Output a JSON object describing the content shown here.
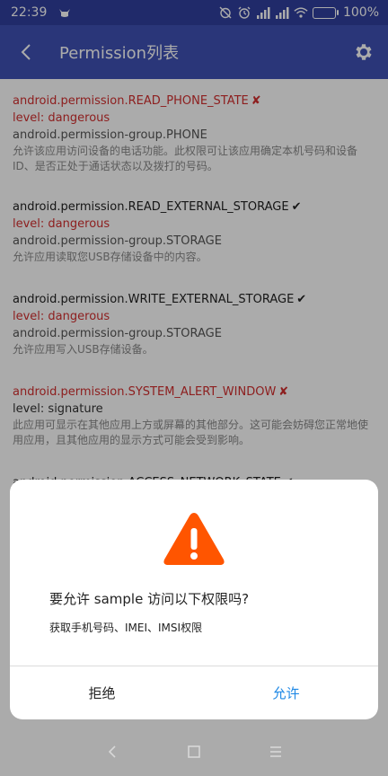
{
  "status_bar": {
    "time": "22:39",
    "battery_percent": "100%",
    "battery_level": 1.0
  },
  "app_bar": {
    "title": "Permission列表"
  },
  "permissions": [
    {
      "name": "android.permission.READ_PHONE_STATE",
      "mark": "✘",
      "granted": false,
      "level": "level: dangerous",
      "group": "android.permission-group.PHONE",
      "description": "允许该应用访问设备的电话功能。此权限可让该应用确定本机号码和设备 ID、是否正处于通话状态以及拨打的号码。"
    },
    {
      "name": "android.permission.READ_EXTERNAL_STORAGE",
      "mark": "✔",
      "granted": true,
      "level": "level: dangerous",
      "group": "android.permission-group.STORAGE",
      "description": "允许应用读取您USB存储设备中的内容。"
    },
    {
      "name": "android.permission.WRITE_EXTERNAL_STORAGE",
      "mark": "✔",
      "granted": true,
      "level": "level: dangerous",
      "group": "android.permission-group.STORAGE",
      "description": "允许应用写入USB存储设备。"
    },
    {
      "name": "android.permission.SYSTEM_ALERT_WINDOW",
      "mark": "✘",
      "granted": false,
      "level": "level: signature",
      "group": "",
      "description": "此应用可显示在其他应用上方或屏幕的其他部分。这可能会妨碍您正常地使用应用，且其他应用的显示方式可能会受到影响。"
    },
    {
      "name": "android.permission.ACCESS_NETWORK_STATE",
      "mark": "✔",
      "granted": true,
      "level": "",
      "group": "",
      "description": ""
    }
  ],
  "dialog": {
    "title": "要允许 sample 访问以下权限吗?",
    "message": "获取手机号码、IMEI、IMSI权限",
    "deny_label": "拒绝",
    "allow_label": "允许"
  },
  "colors": {
    "status_bar": "#303f9f",
    "app_bar": "#3f51b5",
    "danger_red": "#d32f2f",
    "warning_orange": "#ff5500",
    "allow_blue": "#1e88e5"
  }
}
